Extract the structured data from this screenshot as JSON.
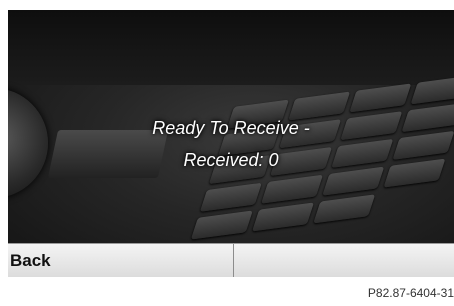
{
  "display": {
    "status_line1": "Ready To Receive -",
    "status_line2": "Received: 0"
  },
  "bottom_bar": {
    "back_label": "Back"
  },
  "caption": "P82.87-6404-31",
  "colors": {
    "status_text": "#ffffff",
    "bar_background": "#e8e8e8"
  }
}
